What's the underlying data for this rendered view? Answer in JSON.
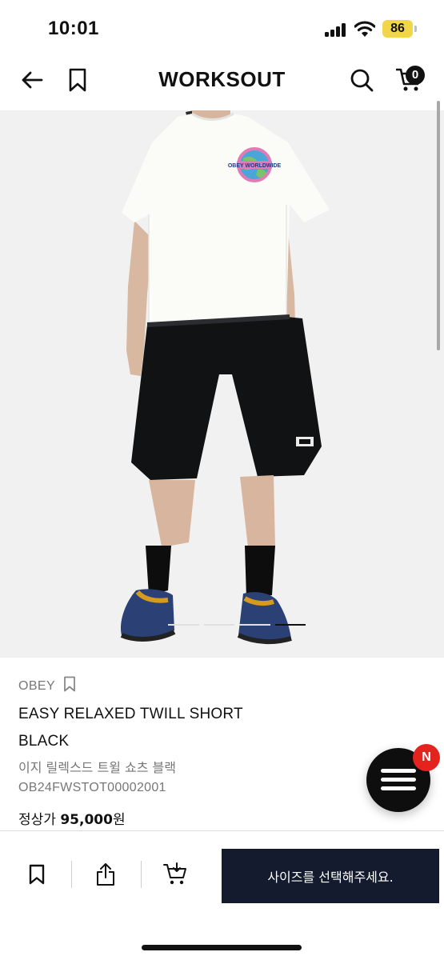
{
  "status_bar": {
    "time": "10:01",
    "battery": "86",
    "battery_color": "#f2d64a"
  },
  "nav": {
    "brand": "WORKSOUT",
    "cart_count": "0",
    "icons": [
      "arrow-left-icon",
      "bookmark-icon",
      "search-icon",
      "cart-icon"
    ]
  },
  "product": {
    "brand": "OBEY",
    "title_line1": "EASY RELAXED TWILL SHORT",
    "title_line2": "BLACK",
    "name_kr": "이지 릴렉스드 트윌 쇼츠 블랙",
    "sku": "OB24FWSTOT00002001",
    "price_label": "정상가",
    "price": "95,000",
    "price_unit": "원",
    "image": {
      "tshirt_print": "OBEY WORLDWIDE",
      "image_count": 4,
      "active_index": 3
    }
  },
  "fab": {
    "badge": "N",
    "badge_color": "#e4231e"
  },
  "bottom_bar": {
    "cta_label": "사이즈를 선택해주세요.",
    "cta_color": "#141b2e"
  }
}
